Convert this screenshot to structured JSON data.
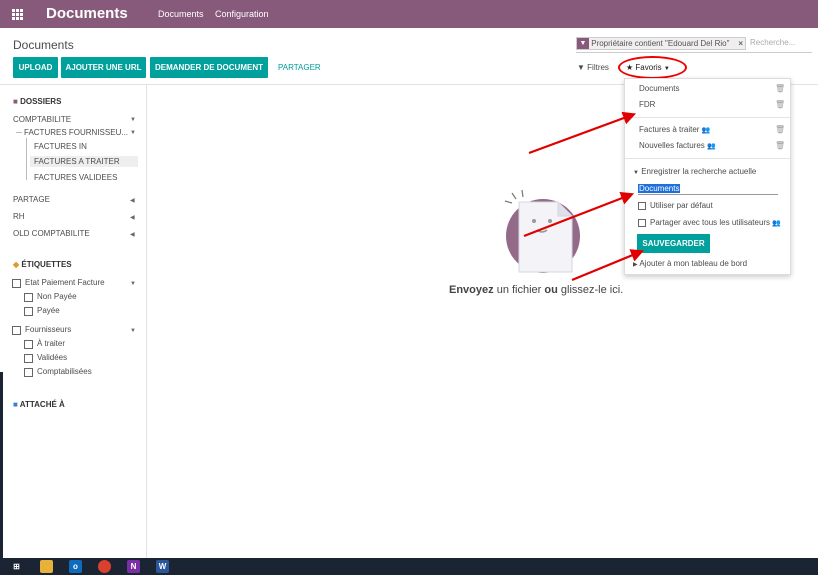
{
  "topbar": {
    "brand": "Documents",
    "menu": [
      "Documents",
      "Configuration"
    ]
  },
  "control_panel": {
    "title": "Documents",
    "buttons": [
      "UPLOAD",
      "AJOUTER UNE URL",
      "DEMANDER DE DOCUMENT"
    ],
    "link": "PARTAGER",
    "facet": "Propriétaire contient \"Edouard Del Rio\"",
    "facet_close": "×",
    "search_placeholder": "Recherche...",
    "filters": "Filtres",
    "favorites": "Favoris"
  },
  "sidebar": {
    "folders_title": "DOSSIERS",
    "folders": {
      "comptabilite": "COMPTABILITE",
      "factures_fournisseurs": "FACTURES FOURNISSEU...",
      "factures_in": "FACTURES IN",
      "factures_a_traiter": "FACTURES A TRAITER",
      "factures_validees": "FACTURES VALIDEES",
      "partage": "PARTAGE",
      "rh": "RH",
      "old_comptabilite": "OLD COMPTABILITE"
    },
    "tags_title": "ÉTIQUETTES",
    "tags": {
      "etat_paiement": "Etat Paiement Facture",
      "non_payee": "Non Payée",
      "payee": "Payée",
      "fournisseurs": "Fournisseurs",
      "a_traiter": "À traiter",
      "validees": "Validées",
      "comptabilisees": "Comptabilisées"
    },
    "attached_title": "ATTACHÉ À"
  },
  "favorites_menu": {
    "items": [
      "Documents",
      "FDR",
      "Factures à traiter",
      "Nouvelles factures"
    ],
    "save_search": "Enregistrer la recherche actuelle",
    "search_name": "Documents",
    "use_default": "Utiliser par défaut",
    "share_all": "Partager avec tous les utilisateurs",
    "save_button": "SAUVEGARDER",
    "add_dashboard": "Ajouter à mon tableau de bord"
  },
  "upload_area": {
    "part1": "Envoyez",
    "part2": " un fichier ",
    "part3": "ou",
    "part4": " glissez-le ici."
  },
  "colors": {
    "brand": "#875a7b",
    "accent": "#00a09d",
    "annotation": "#e00000"
  }
}
